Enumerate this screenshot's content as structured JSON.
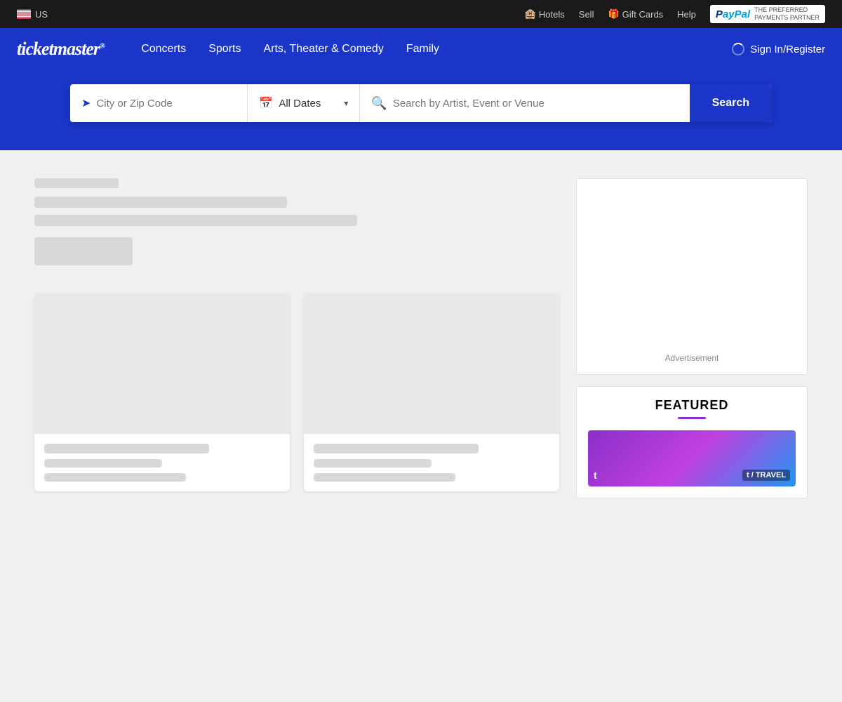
{
  "topbar": {
    "locale": "US",
    "hotels_label": "Hotels",
    "sell_label": "Sell",
    "gift_cards_label": "Gift Cards",
    "help_label": "Help",
    "paypal_label": "THE PREFERRED",
    "paypal_label2": "PAYMENTS PARTNER"
  },
  "nav": {
    "logo": "ticketmaster",
    "logo_reg": "®",
    "links": [
      {
        "label": "Concerts",
        "id": "concerts"
      },
      {
        "label": "Sports",
        "id": "sports"
      },
      {
        "label": "Arts, Theater & Comedy",
        "id": "arts"
      },
      {
        "label": "Family",
        "id": "family"
      }
    ],
    "sign_in": "Sign In/Register"
  },
  "search": {
    "location_placeholder": "City or Zip Code",
    "date_label": "All Dates",
    "query_placeholder": "Search by Artist, Event or Venue",
    "button_label": "Search"
  },
  "featured": {
    "title": "FEATURED",
    "card_label": "t / TRAVEL"
  },
  "ad": {
    "label": "Advertisement"
  }
}
